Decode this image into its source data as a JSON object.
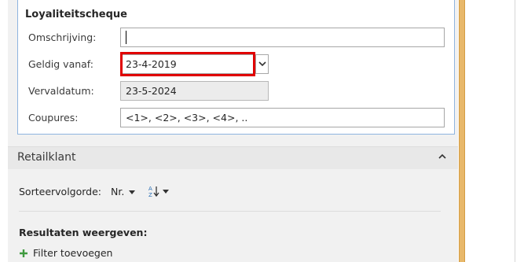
{
  "loyalty": {
    "title": "Loyaliteitscheque",
    "fields": [
      {
        "label": "Omschrijving:",
        "value": ""
      },
      {
        "label": "Geldig vanaf:",
        "value": "23-4-2019"
      },
      {
        "label": "Vervaldatum:",
        "value": "23-5-2024"
      },
      {
        "label": "Coupures:",
        "value": "<1>, <2>, <3>, <4>, .."
      }
    ]
  },
  "retail": {
    "title": "Retailklant",
    "sort_label": "Sorteervolgorde:",
    "sort_value": "Nr.",
    "results_title": "Resultaten weergeven:",
    "filter_label": "Filter toevoegen"
  },
  "colors": {
    "highlight": "#e00000",
    "accent_border": "#8eb4df",
    "side_bar": "#e8b86a",
    "filter_plus": "#3f9a3f"
  }
}
